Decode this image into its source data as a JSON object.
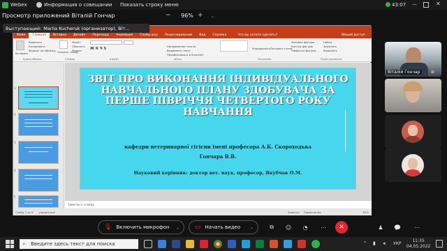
{
  "topbar": {
    "app_name": "Webex",
    "meeting_info": "Информация о совещании",
    "show_strip": "Показать строку меню",
    "time": "43:07"
  },
  "sharebar": {
    "title": "Просмотр приложений Віталій Гончар",
    "zoom": "96%",
    "minus": "−",
    "plus": "+"
  },
  "presenter": {
    "label": "Выступающий:",
    "name": "Mariia Kucheruk (организатор), Віт..."
  },
  "ppt": {
    "tabs": [
      "Файл",
      "Главная",
      "Вставка",
      "Дизайн",
      "Переходы",
      "Анимация",
      "Слайд-шоу",
      "Рецензирование",
      "Вид",
      "Справка"
    ],
    "active_tab": "Главная",
    "tell_me": "Что вы хотите сделать?",
    "share": "Общий доступ",
    "ribbon_items": {
      "paste": "Вставить",
      "cut": "Вырезать",
      "copy": "Копировать",
      "format_painter": "Формат по образцу",
      "new_slide": "Создать слайд",
      "layout": "Макет",
      "reset": "Сбросить",
      "section": "Раздел",
      "shapes_fill": "Заливка фигуры",
      "shapes_outline": "Контур фигуры",
      "shapes_effects": "Эффекты фигуры",
      "arrange": "Упорядочить",
      "styles": "Экспресс-стили",
      "find": "Найти",
      "replace": "Заменить",
      "select": "Выделить",
      "text_direction": "Направление текста",
      "align_text": "Выровнять текст",
      "smartart": "Преобразовать в SmartArt"
    },
    "ribbon_groups": [
      "Буфер обмена",
      "Слайды",
      "Шрифт",
      "Абзац",
      "Рисование",
      "Редактирование"
    ],
    "slide_numbers": [
      "1",
      "2",
      "3",
      "4",
      "5"
    ],
    "slide": {
      "title": "ЗВІТ ПРО ВИКОНАННЯ ІНДИВІДУАЛЬНОГО НАВЧАЛЬНОГО ПЛАНУ ЗДОБУВАЧА ЗА ПЕРШЕ ПІВРІЧЧЯ ЧЕТВЕРТОГО РОКУ НАВЧАННЯ",
      "department": "кафедри ветеринарної гігієни імені професора А.К. Скороходька",
      "author": "Гончара В.В.",
      "supervisor": "Науковий керівник: доктор вет. наук, професор, Якубчак О.М."
    },
    "notes_placeholder": "Заметки к слайду",
    "status": {
      "slide_counter": "Слайд 1 из 9",
      "language": "украинский",
      "notes": "Заметки",
      "comments": "Примечания",
      "zoom": "82%"
    }
  },
  "participants": [
    {
      "name": "Віталій Гончар"
    }
  ],
  "controls": {
    "mic_label": "Включить микрофон",
    "video_label": "Начать видео",
    "leave_color": "#e0262e"
  },
  "taskbar": {
    "search_placeholder": "Введите здесь текст для поиска",
    "lang": "УКР",
    "clock_time": "11:35",
    "clock_date": "04.05.2022"
  }
}
